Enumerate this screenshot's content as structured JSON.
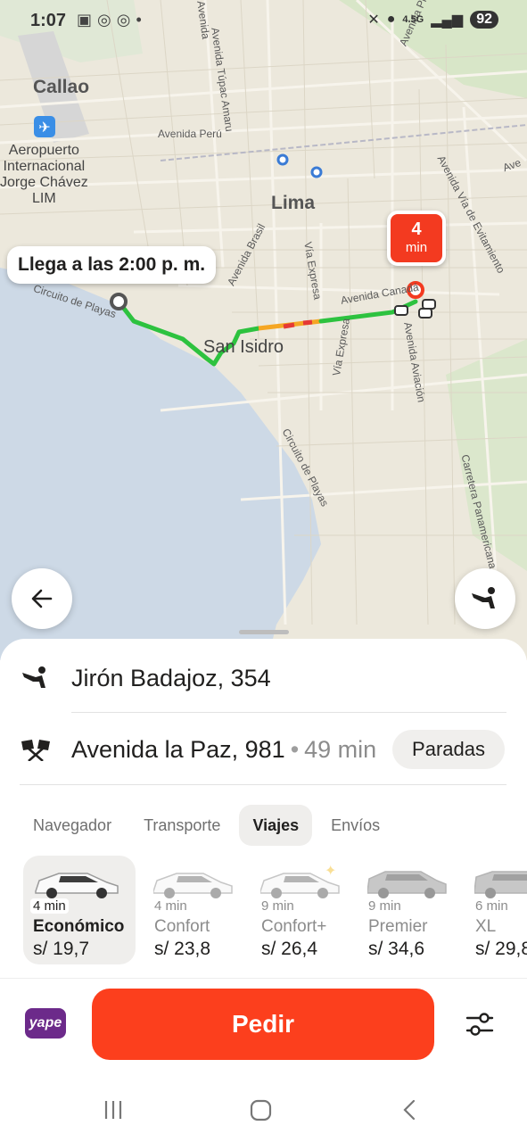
{
  "status_bar": {
    "time": "1:07",
    "network": "4.5G",
    "battery": "92"
  },
  "map": {
    "labels": {
      "callao": "Callao",
      "airport": [
        "Aeropuerto",
        "Internacional",
        "Jorge Chávez",
        "LIM"
      ],
      "lima": "Lima",
      "san_isidro": "San Isidro",
      "av_peru": "Avenida Perú",
      "tupac": "Avenida Túpac Amaru",
      "brasil": "Avenida Brasil",
      "via_expresa": "Vía Expresa",
      "via_expresa2": "Vía Expresa",
      "av_canada": "Avenida Canadá",
      "av_aviacion": "Avenida Aviación",
      "circuito": "Circuito de Playas",
      "circuito2": "Circuito de Playas",
      "panamericana": "Carretera Panamericana",
      "evitamiento": "Avenida Vía de Evitamiento",
      "prolongacion": "Avenida Próceres",
      "avenida_short": "Avenida",
      "av_right": "Ave",
      "av_tomas": "Avenida"
    },
    "arrival_text": "Llega a las 2:00 p. m.",
    "eta": {
      "value": "4",
      "unit": "min"
    }
  },
  "route": {
    "pickup": "Jirón Badajoz, 354",
    "destination": "Avenida la Paz, 981",
    "duration": "49 min",
    "separator": "•",
    "stops_button": "Paradas"
  },
  "tabs": [
    {
      "label": "Navegador",
      "active": false
    },
    {
      "label": "Transporte",
      "active": false
    },
    {
      "label": "Viajes",
      "active": true
    },
    {
      "label": "Envíos",
      "active": false
    }
  ],
  "tariffs": [
    {
      "mins": "4 min",
      "name": "Económico",
      "price": "s/ 19,7",
      "active": true
    },
    {
      "mins": "4 min",
      "name": "Confort",
      "price": "s/ 23,8",
      "active": false
    },
    {
      "mins": "9 min",
      "name": "Confort+",
      "price": "s/ 26,4",
      "active": false
    },
    {
      "mins": "9 min",
      "name": "Premier",
      "price": "s/ 34,6",
      "active": false
    },
    {
      "mins": "6 min",
      "name": "XL",
      "price": "s/ 29,8",
      "active": false
    }
  ],
  "actions": {
    "order_button": "Pedir",
    "payment_logo": "yape"
  },
  "colors": {
    "accent": "#fc3f1d",
    "route_green": "#2dc23f",
    "route_jam": "#f5a623",
    "water": "#cdd9e6"
  },
  "icons": {
    "back": "arrow-left-icon",
    "pickup": "person-waving-icon",
    "destination": "checkered-flags-icon",
    "settings": "sliders-icon"
  }
}
